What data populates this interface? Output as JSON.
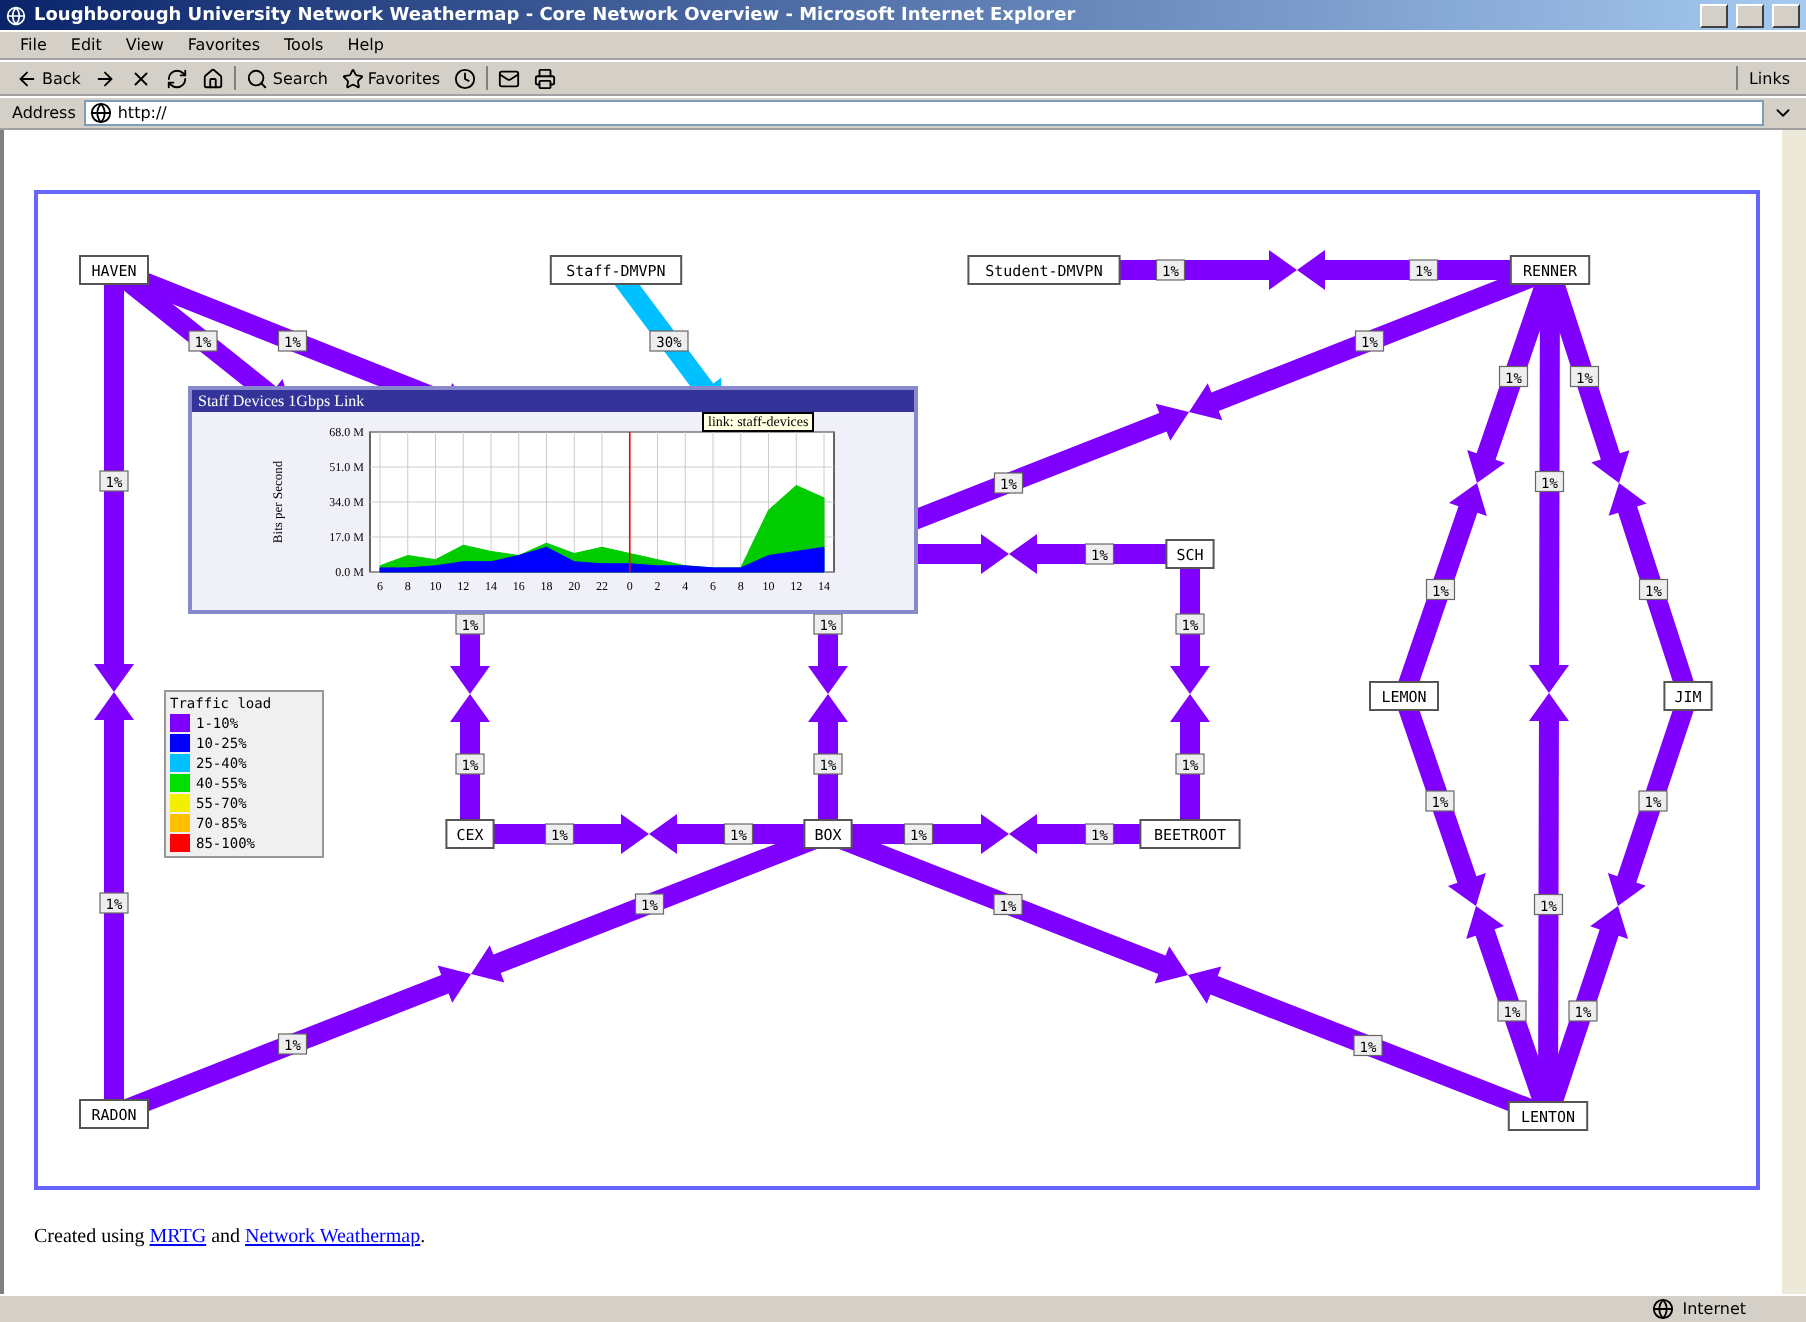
{
  "window": {
    "title": "Loughborough University Network Weathermap - Core Network Overview - Microsoft Internet Explorer"
  },
  "menu": [
    "File",
    "Edit",
    "View",
    "Favorites",
    "Tools",
    "Help"
  ],
  "toolbar": {
    "back": "Back",
    "search": "Search",
    "favorites": "Favorites",
    "links": "Links"
  },
  "address": {
    "label": "Address",
    "value": "http://"
  },
  "map": {
    "nodes": [
      {
        "label": "HAVEN"
      },
      {
        "label": "Staff-DMVPN"
      },
      {
        "label": "Student-DMVPN"
      },
      {
        "label": "RENNER"
      },
      {
        "label": "CEX"
      },
      {
        "label": "BOX"
      },
      {
        "label": "SCH"
      },
      {
        "label": "BEETROOT"
      },
      {
        "label": "LEMON"
      },
      {
        "label": "JIM"
      },
      {
        "label": "RADON"
      },
      {
        "label": "LENTON"
      }
    ],
    "links": [
      {
        "label_a": "1%",
        "label_b": "1%",
        "color": "#8000ff"
      },
      {
        "label_a": "1%",
        "color": "#8000ff"
      },
      {
        "label_a": "1%",
        "color": "#8000ff"
      },
      {
        "label_a": "30%",
        "color": "#00c0ff"
      },
      {
        "label_a": "1%",
        "label_b": "1%",
        "color": "#8000ff"
      },
      {
        "label_a": "1%",
        "label_b": "1%",
        "color": "#8000ff"
      },
      {
        "label_a": "1%",
        "label_b": "1%",
        "color": "#8000ff"
      },
      {
        "label_a": "1%",
        "label_b": "1%",
        "color": "#8000ff"
      },
      {
        "label_b": "1%",
        "color": "#8000ff"
      },
      {
        "label_a": "1%",
        "label_b": "1%",
        "color": "#8000ff"
      },
      {
        "label_a": "1%",
        "label_b": "1%",
        "color": "#8000ff"
      },
      {
        "label_a": "1%",
        "label_b": "1%",
        "color": "#8000ff"
      },
      {
        "label_a": "1%",
        "label_b": "1%",
        "color": "#8000ff"
      },
      {
        "label_a": "1%",
        "label_b": "1%",
        "color": "#8000ff"
      },
      {
        "label_a": "1%",
        "label_b": "1%",
        "color": "#8000ff"
      },
      {
        "label_a": "1%",
        "label_b": "1%",
        "color": "#8000ff"
      },
      {
        "label_a": "1%",
        "label_b": "1%",
        "color": "#8000ff"
      },
      {
        "label_a": "1%",
        "label_b": "1%",
        "color": "#8000ff"
      },
      {
        "label_a": "1%",
        "label_b": "1%",
        "color": "#8000ff"
      }
    ],
    "legend": {
      "title": "Traffic load",
      "items": [
        {
          "label": "1-10%",
          "color": "#8000ff"
        },
        {
          "label": "10-25%",
          "color": "#0000ff"
        },
        {
          "label": "25-40%",
          "color": "#00c0ff"
        },
        {
          "label": "40-55%",
          "color": "#00e000"
        },
        {
          "label": "55-70%",
          "color": "#f0f000"
        },
        {
          "label": "70-85%",
          "color": "#ffc000"
        },
        {
          "label": "85-100%",
          "color": "#ff0000"
        }
      ]
    },
    "popup": {
      "title": "Staff Devices 1Gbps Link",
      "tooltip": "link: staff-devices",
      "chart_data": {
        "type": "area",
        "ylabel": "Bits per Second",
        "categories": [
          "6",
          "8",
          "10",
          "12",
          "14",
          "16",
          "18",
          "20",
          "22",
          "0",
          "2",
          "4",
          "6",
          "8",
          "10",
          "12",
          "14"
        ],
        "series": [
          {
            "color": "#00cc00",
            "values": [
              3,
              8,
              6,
              13,
              10,
              8,
              14,
              9,
              12,
              9,
              6,
              3,
              2,
              2,
              30,
              42,
              36
            ]
          },
          {
            "color": "#0000ff",
            "values": [
              2,
              2,
              3,
              5,
              5,
              8,
              12,
              5,
              4,
              4,
              3,
              3,
              2,
              2,
              8,
              10,
              12
            ]
          }
        ],
        "grid": true,
        "ylim": [
          0,
          68
        ],
        "yticks": [
          {
            "value": 0,
            "label": "0.0 M"
          },
          {
            "value": 17,
            "label": "17.0 M"
          },
          {
            "value": 34,
            "label": "34.0 M"
          },
          {
            "value": 51,
            "label": "51.0 M"
          },
          {
            "value": 68,
            "label": "68.0 M"
          }
        ],
        "ref_lines": [
          {
            "axis": "x",
            "value": "0",
            "color": "#ff0000"
          }
        ]
      }
    }
  },
  "footer": [
    {
      "kind": "text",
      "text": "Created using "
    },
    {
      "kind": "link",
      "text": "MRTG"
    },
    {
      "kind": "text",
      "text": " and "
    },
    {
      "kind": "link",
      "text": "Network Weathermap"
    },
    {
      "kind": "text",
      "text": "."
    }
  ],
  "status_bar": {
    "zone": "Internet"
  }
}
